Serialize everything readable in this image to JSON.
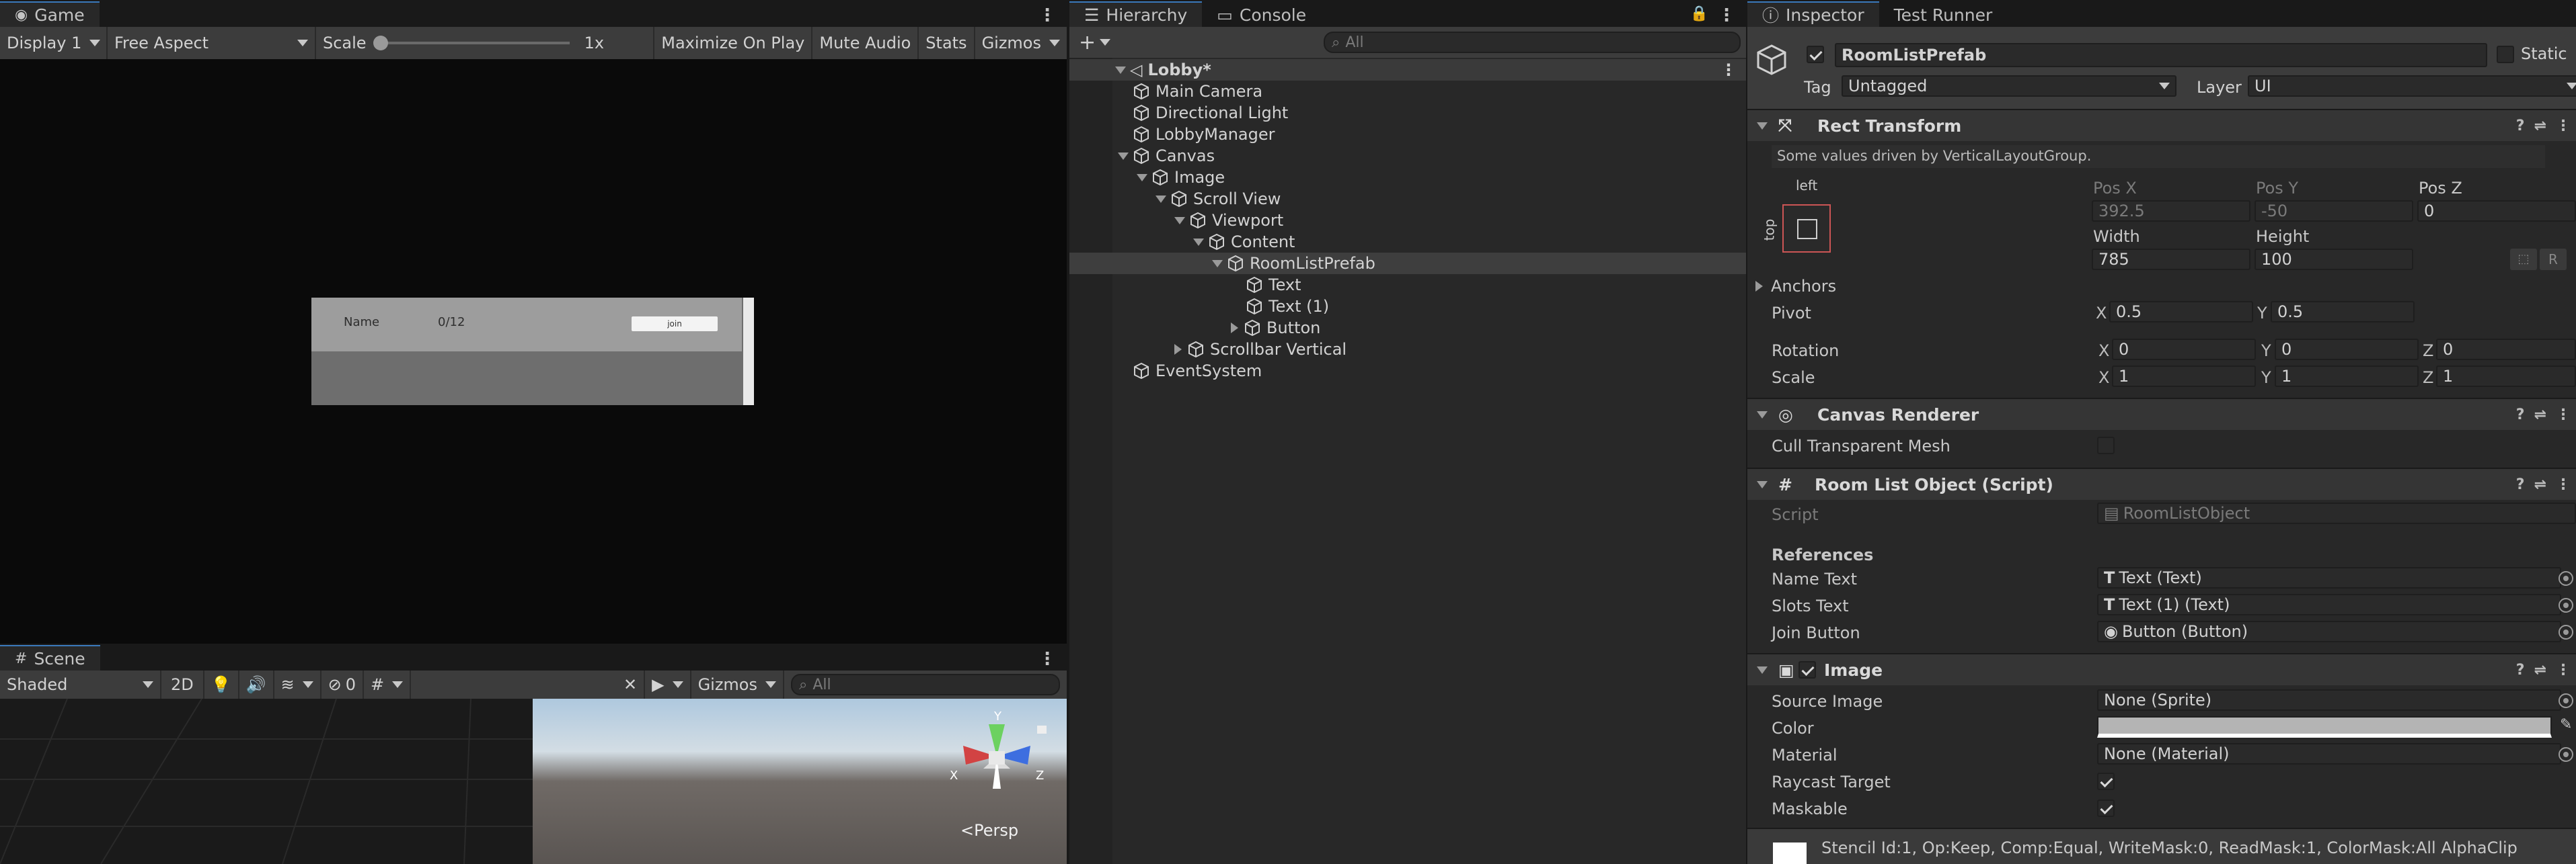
{
  "game": {
    "tab": "Game",
    "display": "Display 1",
    "aspect": "Free Aspect",
    "scale_label": "Scale",
    "scale_value": "1x",
    "maximize": "Maximize On Play",
    "mute": "Mute Audio",
    "stats": "Stats",
    "gizmos": "Gizmos",
    "room": {
      "name": "Name",
      "slots": "0/12",
      "join": "join"
    }
  },
  "scene": {
    "tab": "Scene",
    "shading": "Shaded",
    "mode2d": "2D",
    "hidden_count": "0",
    "gizmos": "Gizmos",
    "search_placeholder": "All",
    "persp": "Persp",
    "axes": {
      "x": "X",
      "y": "Y",
      "z": "Z"
    }
  },
  "hierarchy": {
    "tab": "Hierarchy",
    "console_tab": "Console",
    "search_placeholder": "All",
    "scene_name": "Lobby*",
    "items": [
      {
        "label": "Main Camera"
      },
      {
        "label": "Directional Light"
      },
      {
        "label": "LobbyManager"
      },
      {
        "label": "Canvas"
      },
      {
        "label": "Image"
      },
      {
        "label": "Scroll View"
      },
      {
        "label": "Viewport"
      },
      {
        "label": "Content"
      },
      {
        "label": "RoomListPrefab"
      },
      {
        "label": "Text"
      },
      {
        "label": "Text (1)"
      },
      {
        "label": "Button"
      },
      {
        "label": "Scrollbar Vertical"
      },
      {
        "label": "EventSystem"
      }
    ]
  },
  "inspector": {
    "tab": "Inspector",
    "runner_tab": "Test Runner",
    "object_name": "RoomListPrefab",
    "static_label": "Static",
    "tag_label": "Tag",
    "tag_value": "Untagged",
    "layer_label": "Layer",
    "layer_value": "UI",
    "rect": {
      "title": "Rect Transform",
      "note": "Some values driven by VerticalLayoutGroup.",
      "anchor_h": "left",
      "anchor_v": "top",
      "posx_label": "Pos X",
      "posx": "392.5",
      "posy_label": "Pos Y",
      "posy": "-50",
      "posz_label": "Pos Z",
      "posz": "0",
      "width_label": "Width",
      "width": "785",
      "height_label": "Height",
      "height": "100",
      "r_button": "R",
      "anchors": "Anchors",
      "pivot": "Pivot",
      "pivot_x": "0.5",
      "pivot_y": "0.5",
      "rotation": "Rotation",
      "rot_x": "0",
      "rot_y": "0",
      "rot_z": "0",
      "scale": "Scale",
      "scale_x": "1",
      "scale_y": "1",
      "scale_z": "1",
      "x": "X",
      "y": "Y",
      "z": "Z"
    },
    "canvas_renderer": {
      "title": "Canvas Renderer",
      "cull": "Cull Transparent Mesh"
    },
    "script_comp": {
      "title": "Room List Object (Script)",
      "script_label": "Script",
      "script_value": "RoomListObject",
      "references": "References",
      "name_text_label": "Name Text",
      "name_text_value": "Text (Text)",
      "slots_text_label": "Slots Text",
      "slots_text_value": "Text (1) (Text)",
      "join_label": "Join Button",
      "join_value": "Button (Button)"
    },
    "image": {
      "title": "Image",
      "source_label": "Source Image",
      "source_value": "None (Sprite)",
      "color_label": "Color",
      "material_label": "Material",
      "material_value": "None (Material)",
      "raycast_label": "Raycast Target",
      "maskable_label": "Maskable",
      "stencil": "Stencil Id:1, Op:Keep, Comp:Equal, WriteMask:0, ReadMask:1, ColorMask:All AlphaClip"
    }
  },
  "colors": {
    "accent": "#3a79bb",
    "selected_row": "#3e3e3e",
    "image_color": "#b4b4b4"
  }
}
